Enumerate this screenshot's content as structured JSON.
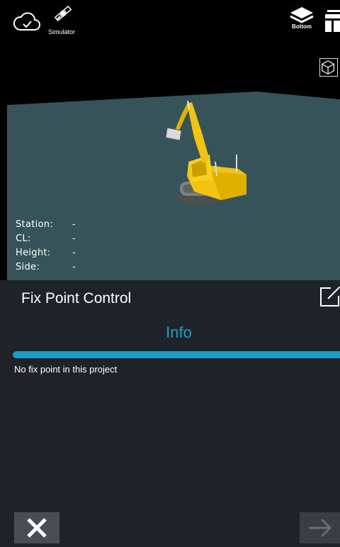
{
  "topbar": {
    "cloud_icon": "cloud-check-icon",
    "satellite_icon": "satellite-icon",
    "simulator_label": "Simulator",
    "layers_icon": "layers-icon",
    "layers_label": "Bottom",
    "tiles_icon": "tiles-icon",
    "cube_icon": "cube-view-icon"
  },
  "viewport": {
    "readouts": [
      {
        "label": "Station:",
        "value": "-"
      },
      {
        "label": "CL:",
        "value": "-"
      },
      {
        "label": "Height:",
        "value": "-"
      },
      {
        "label": "Side:",
        "value": "-"
      }
    ]
  },
  "panel": {
    "title": "Fix Point Control",
    "tab_label": "Info",
    "message": "No fix point in this project",
    "close_icon": "close-icon",
    "next_icon": "arrow-right-icon",
    "accent_color": "#1a9cc4"
  }
}
